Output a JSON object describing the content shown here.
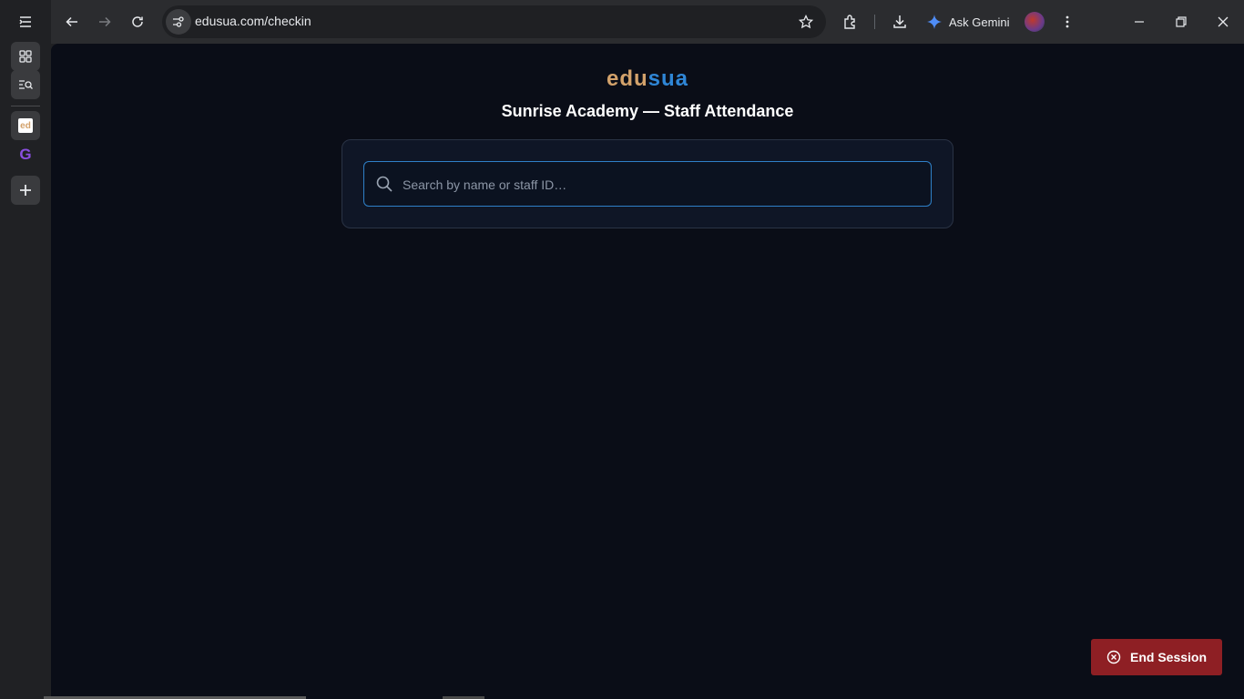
{
  "browser": {
    "url": "edusua.com/checkin",
    "gemini_label": "Ask Gemini"
  },
  "sidebar": {
    "favicons": [
      "edusua-favicon",
      "grammarly-favicon"
    ],
    "edusua_favicon_text": "ed",
    "grammarly_favicon_text": "G"
  },
  "page": {
    "logo_part1": "edu",
    "logo_part2": "sua",
    "title": "Sunrise Academy — Staff Attendance",
    "search": {
      "placeholder": "Search by name or staff ID…",
      "value": ""
    },
    "end_session_label": "End Session"
  },
  "colors": {
    "logo_edu": "#d3a26b",
    "logo_sua": "#2f86d6",
    "page_bg": "#0a0d17",
    "end_button": "#8e1f24",
    "search_border": "#2f80c8"
  }
}
